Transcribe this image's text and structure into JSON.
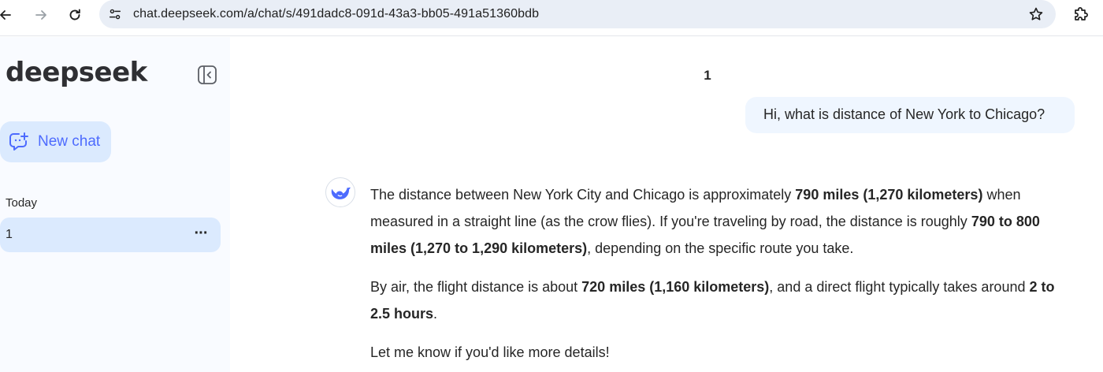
{
  "browser": {
    "url": "chat.deepseek.com/a/chat/s/491dadc8-091d-43a3-bb05-491a51360bdb"
  },
  "sidebar": {
    "logo": "deepseek",
    "new_chat_label": "New chat",
    "section_label": "Today",
    "chats": [
      {
        "label": "1",
        "more": "···"
      }
    ]
  },
  "main": {
    "title": "1",
    "user_message": "Hi, what is distance of New York to Chicago?",
    "answer": {
      "p1": {
        "t1": "The distance between New York City and Chicago is approximately ",
        "b1": "790 miles (1,270 kilometers)",
        "t2": " when measured in a straight line (as the crow flies). If you're traveling by road, the distance is roughly ",
        "b2": "790 to 800 miles (1,270 to 1,290 kilometers)",
        "t3": ", depending on the specific route you take."
      },
      "p2": {
        "t1": "By air, the flight distance is about ",
        "b1": "720 miles (1,160 kilometers)",
        "t2": ", and a direct flight typically takes around ",
        "b2": "2 to 2.5 hours",
        "t3": "."
      },
      "p3": "Let me know if you'd like more details!"
    }
  },
  "colors": {
    "accent": "#4d6bfe",
    "sidebar_bg": "#f9fbff",
    "selected_bg": "#dbeafe",
    "user_bubble_bg": "#eff6ff"
  },
  "icons": {
    "back": "arrow-left-icon",
    "forward": "arrow-right-icon",
    "reload": "reload-icon",
    "site_info": "tune-icon",
    "bookmark": "star-icon",
    "extensions": "puzzle-icon",
    "collapse": "sidebar-collapse-icon",
    "new_chat": "chat-plus-icon",
    "avatar": "deepseek-whale-icon"
  }
}
